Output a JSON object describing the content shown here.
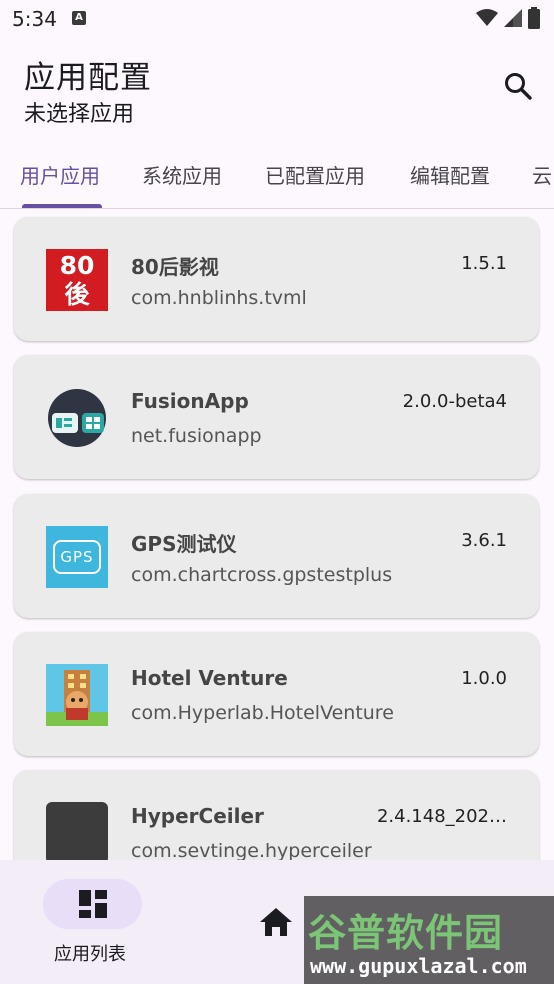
{
  "status_bar": {
    "time": "5:34",
    "badge": "A"
  },
  "app_bar": {
    "title": "应用配置",
    "subtitle": "未选择应用"
  },
  "tabs": [
    {
      "label": "用户应用",
      "active": true
    },
    {
      "label": "系统应用",
      "active": false
    },
    {
      "label": "已配置应用",
      "active": false
    },
    {
      "label": "编辑配置",
      "active": false
    },
    {
      "label": "云",
      "active": false
    }
  ],
  "apps": [
    {
      "name": "80后影视",
      "package": "com.hnblinhs.tvml",
      "version": "1.5.1",
      "icon": "80hou-logo-icon",
      "icon_text": "80後"
    },
    {
      "name": "FusionApp",
      "package": "net.fusionapp",
      "version": "2.0.0-beta4",
      "icon": "fusionapp-icon"
    },
    {
      "name": "GPS测试仪",
      "package": "com.chartcross.gpstestplus",
      "version": "3.6.1",
      "icon": "gps-test-icon",
      "icon_text": "GPS"
    },
    {
      "name": "Hotel Venture",
      "package": "com.Hyperlab.HotelVenture",
      "version": "1.0.0",
      "icon": "hotel-venture-icon"
    },
    {
      "name": "HyperCeiler",
      "package": "com.sevtinge.hyperceiler",
      "version": "2.4.148_202…",
      "icon": "hyperceiler-icon"
    }
  ],
  "bottom_nav": {
    "active_label": "应用列表"
  },
  "watermark": {
    "title": "谷普软件园",
    "url": "www.gupuxlazal.com"
  },
  "colors": {
    "accent": "#6750a4",
    "card": "#ebebeb",
    "background": "#fdf8fd",
    "nav_bg": "#f3edf7",
    "nav_pill": "#e8def8"
  }
}
